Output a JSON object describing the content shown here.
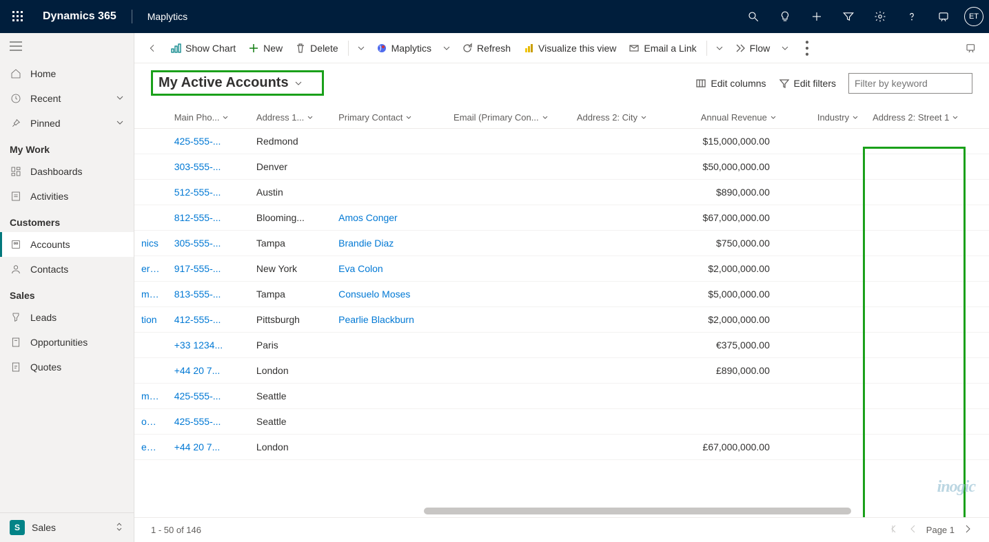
{
  "navbar": {
    "brand": "Dynamics 365",
    "app": "Maplytics",
    "avatar": "ET"
  },
  "sidebar": {
    "home": "Home",
    "recent": "Recent",
    "pinned": "Pinned",
    "group_mywork": "My Work",
    "dashboards": "Dashboards",
    "activities": "Activities",
    "group_customers": "Customers",
    "accounts": "Accounts",
    "contacts": "Contacts",
    "group_sales": "Sales",
    "leads": "Leads",
    "opportunities": "Opportunities",
    "quotes": "Quotes",
    "area_badge": "S",
    "area_label": "Sales"
  },
  "cmdbar": {
    "show_chart": "Show Chart",
    "new": "New",
    "delete": "Delete",
    "maplytics": "Maplytics",
    "refresh": "Refresh",
    "visualize": "Visualize this view",
    "email": "Email a Link",
    "flow": "Flow"
  },
  "view": {
    "title": "My Active Accounts",
    "edit_columns": "Edit columns",
    "edit_filters": "Edit filters",
    "filter_placeholder": "Filter by keyword"
  },
  "columns": {
    "c0": "Main Pho...",
    "c1": "Address 1...",
    "c2": "Primary Contact",
    "c3": "Email (Primary Con...",
    "c4": "Address 2: City",
    "c5": "Annual Revenue",
    "c6": "Industry",
    "c7": "Address 2: Street 1"
  },
  "rows": [
    {
      "name": "",
      "phone": "425-555-...",
      "addr1": "Redmond",
      "contact": "",
      "email": "",
      "city": "",
      "rev": "$15,000,000.00",
      "ind": ""
    },
    {
      "name": "",
      "phone": "303-555-...",
      "addr1": "Denver",
      "contact": "",
      "email": "",
      "city": "",
      "rev": "$50,000,000.00",
      "ind": ""
    },
    {
      "name": "",
      "phone": "512-555-...",
      "addr1": "Austin",
      "contact": "",
      "email": "",
      "city": "",
      "rev": "$890,000.00",
      "ind": ""
    },
    {
      "name": "",
      "phone": "812-555-...",
      "addr1": "Blooming...",
      "contact": "Amos Conger",
      "email": "",
      "city": "",
      "rev": "$67,000,000.00",
      "ind": ""
    },
    {
      "name": "nics",
      "phone": "305-555-...",
      "addr1": "Tampa",
      "contact": "Brandie Diaz",
      "email": "",
      "city": "",
      "rev": "$750,000.00",
      "ind": ""
    },
    {
      "name": "ering",
      "phone": "917-555-...",
      "addr1": "New York",
      "contact": "Eva Colon",
      "email": "",
      "city": "",
      "rev": "$2,000,000.00",
      "ind": ""
    },
    {
      "name": "mentation",
      "phone": "813-555-...",
      "addr1": "Tampa",
      "contact": "Consuelo Moses",
      "email": "",
      "city": "",
      "rev": "$5,000,000.00",
      "ind": ""
    },
    {
      "name": "tion",
      "phone": "412-555-...",
      "addr1": "Pittsburgh",
      "contact": "Pearlie Blackburn",
      "email": "",
      "city": "",
      "rev": "$2,000,000.00",
      "ind": ""
    },
    {
      "name": "",
      "phone": "+33 1234...",
      "addr1": "Paris",
      "contact": "",
      "email": "",
      "city": "",
      "rev": "€375,000.00",
      "ind": ""
    },
    {
      "name": "",
      "phone": "+44 20 7...",
      "addr1": "London",
      "contact": "",
      "email": "",
      "city": "",
      "rev": "£890,000.00",
      "ind": ""
    },
    {
      "name": "mbly",
      "phone": "425-555-...",
      "addr1": "Seattle",
      "contact": "",
      "email": "",
      "city": "",
      "rev": "",
      "ind": ""
    },
    {
      "name": "onics",
      "phone": "425-555-...",
      "addr1": "Seattle",
      "contact": "",
      "email": "",
      "city": "",
      "rev": "",
      "ind": ""
    },
    {
      "name": "eering",
      "phone": "+44 20 7...",
      "addr1": "London",
      "contact": "",
      "email": "",
      "city": "",
      "rev": "£67,000,000.00",
      "ind": ""
    }
  ],
  "footer": {
    "count": "1 - 50 of 146",
    "page": "Page 1"
  },
  "watermark": "inogic"
}
